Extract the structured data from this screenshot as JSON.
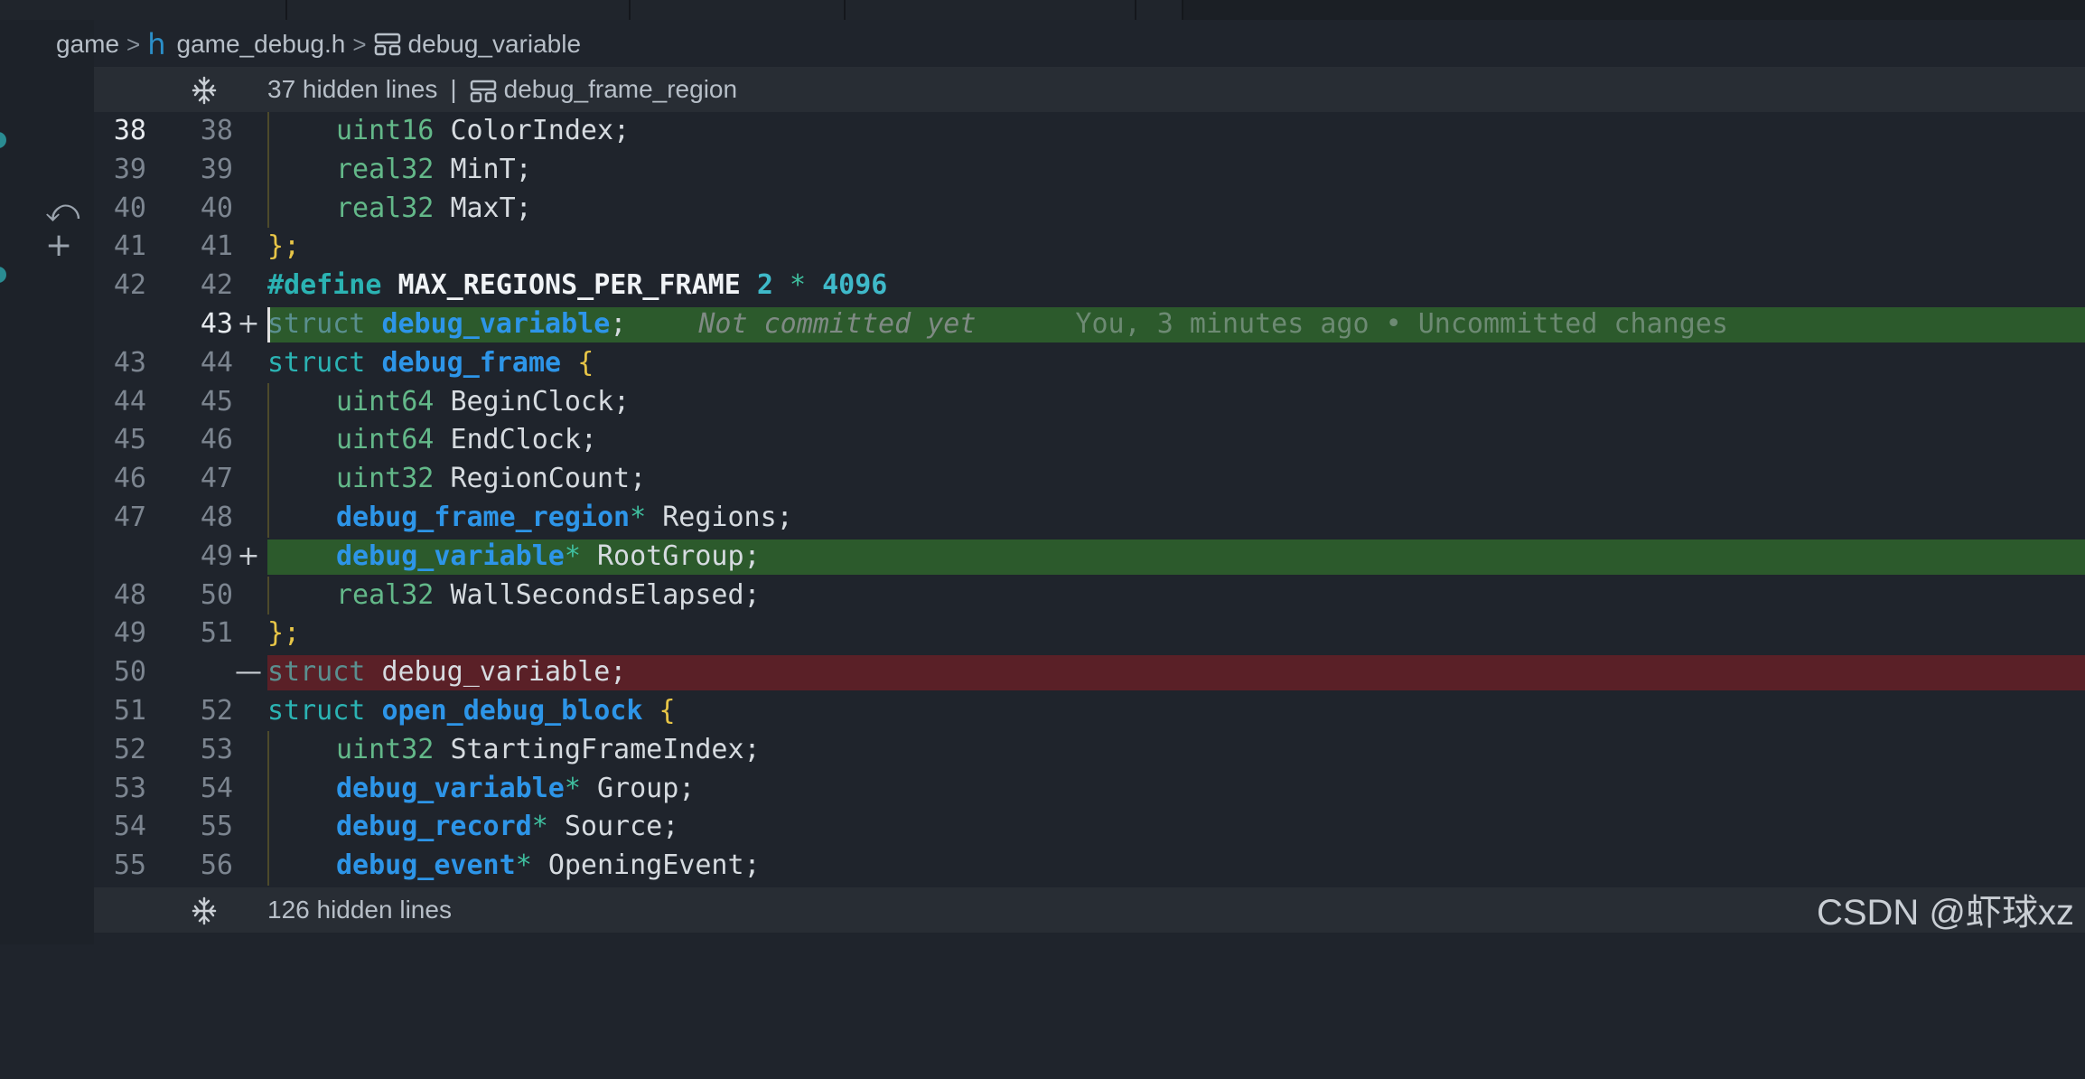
{
  "breadcrumb": {
    "folder": "game",
    "file_icon": "h",
    "file": "game_debug.h",
    "symbol": "debug_variable"
  },
  "fold_top": {
    "hidden": "37 hidden lines",
    "pipe": "|",
    "symbol": "debug_frame_region"
  },
  "fold_bottom": {
    "hidden": "126 hidden lines"
  },
  "blame": {
    "status": "Not committed yet",
    "info": "You, 3 minutes ago • Uncommitted changes"
  },
  "lines": {
    "l38": {
      "a": "38",
      "b": "38"
    },
    "l39": {
      "a": "39",
      "b": "39"
    },
    "l40": {
      "a": "40",
      "b": "40"
    },
    "l41": {
      "a": "41",
      "b": "41"
    },
    "l42": {
      "a": "42",
      "b": "42"
    },
    "l43": {
      "a": "",
      "b": "43"
    },
    "l44": {
      "a": "43",
      "b": "44"
    },
    "l45": {
      "a": "44",
      "b": "45"
    },
    "l46": {
      "a": "45",
      "b": "46"
    },
    "l47": {
      "a": "46",
      "b": "47"
    },
    "l48": {
      "a": "47",
      "b": "48"
    },
    "l49": {
      "a": "",
      "b": "49"
    },
    "l50": {
      "a": "48",
      "b": "50"
    },
    "l51": {
      "a": "49",
      "b": "51"
    },
    "l52": {
      "a": "50",
      "b": ""
    },
    "l53": {
      "a": "51",
      "b": "52"
    },
    "l54": {
      "a": "52",
      "b": "53"
    },
    "l55": {
      "a": "53",
      "b": "54"
    },
    "l56": {
      "a": "54",
      "b": "55"
    },
    "l57": {
      "a": "55",
      "b": "56"
    }
  },
  "markers": {
    "add": "+",
    "remove": "—"
  },
  "tokens": {
    "uint16": "uint16",
    "uint32": "uint32",
    "uint64": "uint64",
    "real32": "real32",
    "struct": "struct",
    "define": "#define",
    "star": "*",
    "semi": ";",
    "open": "{",
    "close": "};",
    "ColorIndex": "ColorIndex;",
    "MinT": "MinT;",
    "MaxT": "MaxT;",
    "macro": "MAX_REGIONS_PER_FRAME",
    "n2": "2",
    "n4096": "4096",
    "debug_variable": "debug_variable",
    "debug_frame": "debug_frame",
    "BeginClock": "BeginClock;",
    "EndClock": "EndClock;",
    "RegionCount": "RegionCount;",
    "debug_frame_region": "debug_frame_region",
    "Regions": "Regions;",
    "RootGroup": "RootGroup;",
    "WallSecondsElapsed": "WallSecondsElapsed;",
    "debug_variable_semi": "debug_variable;",
    "open_debug_block": "open_debug_block",
    "StartingFrameIndex": "StartingFrameIndex;",
    "Group": "Group;",
    "debug_record": "debug_record",
    "Source": "Source;",
    "debug_event": "debug_event",
    "OpeningEvent": "OpeningEvent;"
  },
  "watermark": "CSDN @虾球xz"
}
